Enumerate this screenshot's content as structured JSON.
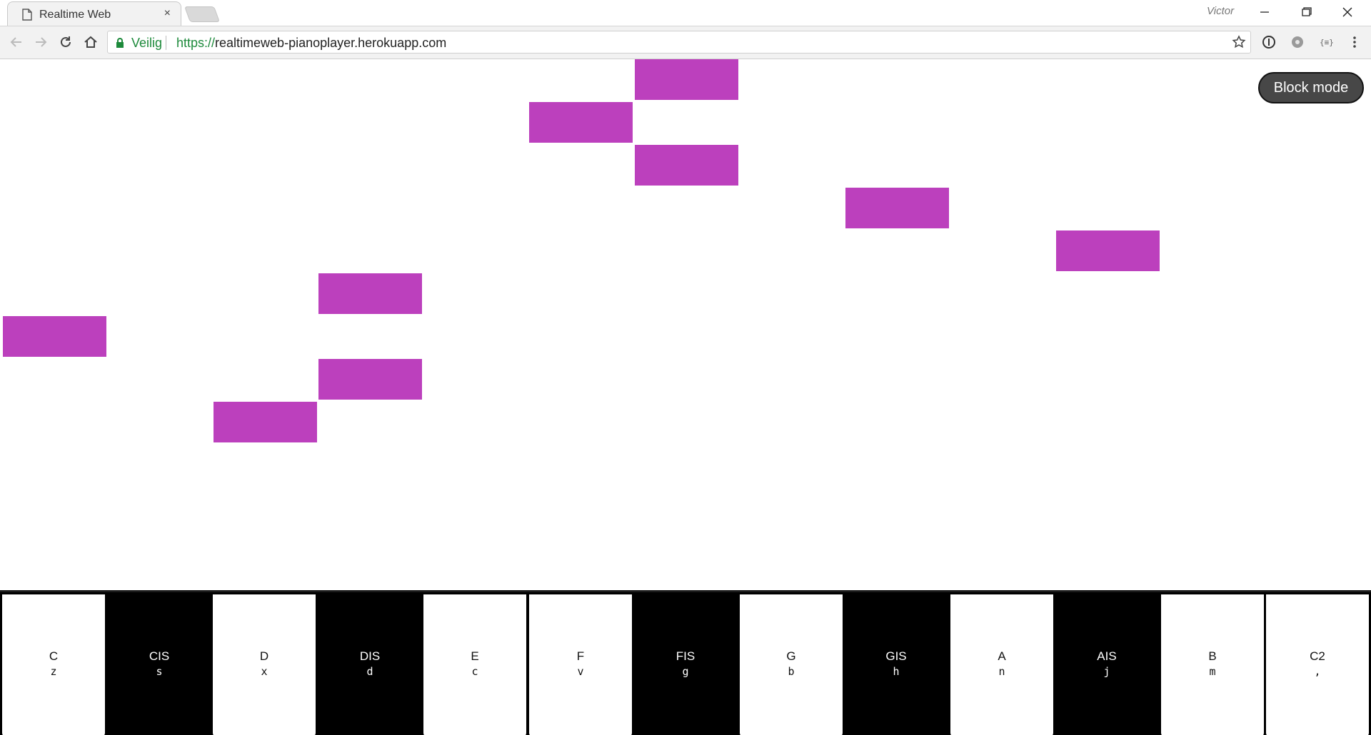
{
  "browser": {
    "tab_title": "Realtime Web",
    "tab_close": "×",
    "profile_name": "Victor",
    "security_label": "Veilig",
    "url_scheme": "https://",
    "url_host": "realtimeweb-pianoplayer.herokuapp.com"
  },
  "page": {
    "block_mode_label": "Block mode",
    "note_color": "#bc40bd"
  },
  "piano": {
    "keys": [
      {
        "note": "C",
        "hint": "z",
        "color": "white"
      },
      {
        "note": "CIS",
        "hint": "s",
        "color": "black"
      },
      {
        "note": "D",
        "hint": "x",
        "color": "white"
      },
      {
        "note": "DIS",
        "hint": "d",
        "color": "black"
      },
      {
        "note": "E",
        "hint": "c",
        "color": "white"
      },
      {
        "note": "F",
        "hint": "v",
        "color": "white"
      },
      {
        "note": "FIS",
        "hint": "g",
        "color": "black"
      },
      {
        "note": "G",
        "hint": "b",
        "color": "white"
      },
      {
        "note": "GIS",
        "hint": "h",
        "color": "black"
      },
      {
        "note": "A",
        "hint": "n",
        "color": "white"
      },
      {
        "note": "AIS",
        "hint": "j",
        "color": "black"
      },
      {
        "note": "B",
        "hint": "m",
        "color": "white"
      },
      {
        "note": "C2",
        "hint": ",",
        "color": "white"
      }
    ]
  }
}
